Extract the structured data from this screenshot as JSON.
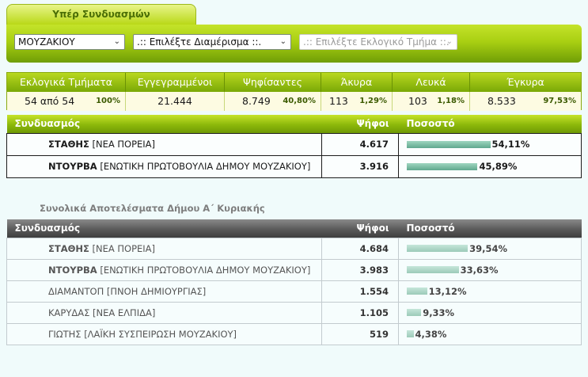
{
  "tab_title": "Υπέρ Συνδυασμών",
  "selectors": {
    "municipality": "ΜΟΥΖΑΚΙΟΥ",
    "district": ".:: Επιλέξτε Διαμέρισμα ::.",
    "section": ".:: Επιλέξτε Εκλογικό Τμήμα ::."
  },
  "stats": {
    "headers": [
      "Εκλογικά Τμήματα",
      "Εγγεγραμμένοι",
      "Ψηφίσαντες",
      "Άκυρα",
      "Λευκά",
      "Έγκυρα"
    ],
    "sections_value": "54 από 54",
    "sections_pct": "100%",
    "registered": "21.444",
    "voted": "8.749",
    "voted_pct": "40,80%",
    "invalid": "113",
    "invalid_pct": "1,29%",
    "blank": "103",
    "blank_pct": "1,18%",
    "valid": "8.533",
    "valid_pct": "97,53%"
  },
  "results_table": {
    "headers": {
      "combination": "Συνδυασμός",
      "votes": "Ψήφοι",
      "percent": "Ποσοστό"
    },
    "rows": [
      {
        "name": "ΣΤΑΘΗΣ",
        "party": "[ΝΕΑ ΠΟΡΕΙΑ]",
        "votes": "4.617",
        "percent": "54,11%",
        "share": 54.11
      },
      {
        "name": "ΝΤΟΥΡΒΑ",
        "party": "[ΕΝΩΤΙΚΗ ΠΡΩΤΟΒΟΥΛΙΑ ΔΗΜΟΥ ΜΟΥΖΑΚΙΟΥ]",
        "votes": "3.916",
        "percent": "45,89%",
        "share": 45.89
      }
    ]
  },
  "overall_title": "Συνολικά Αποτελέσματα Δήμου Α΄ Κυριακής",
  "overall_table": {
    "headers": {
      "combination": "Συνδυασμός",
      "votes": "Ψήφοι",
      "percent": "Ποσοστό"
    },
    "rows": [
      {
        "name": "ΣΤΑΘΗΣ",
        "party": "[ΝΕΑ ΠΟΡΕΙΑ]",
        "votes": "4.684",
        "percent": "39,54%",
        "share": 39.54,
        "bold": true
      },
      {
        "name": "ΝΤΟΥΡΒΑ",
        "party": "[ΕΝΩΤΙΚΗ ΠΡΩΤΟΒΟΥΛΙΑ ΔΗΜΟΥ ΜΟΥΖΑΚΙΟΥ]",
        "votes": "3.983",
        "percent": "33,63%",
        "share": 33.63,
        "bold": true
      },
      {
        "name": "ΔΙΑΜΑΝΤΟΠ",
        "party": "[ΠΝΟΗ ΔΗΜΙΟΥΡΓΙΑΣ]",
        "votes": "1.554",
        "percent": "13,12%",
        "share": 13.12,
        "bold": false
      },
      {
        "name": "ΚΑΡΥΔΑΣ",
        "party": "[ΝΕΑ ΕΛΠΙΔΑ]",
        "votes": "1.105",
        "percent": "9,33%",
        "share": 9.33,
        "bold": false
      },
      {
        "name": "ΓΙΩΤΗΣ",
        "party": "[ΛΑΪΚΗ ΣΥΣΠΕΙΡΩΣΗ ΜΟΥΖΑΚΙΟΥ]",
        "votes": "519",
        "percent": "4,38%",
        "share": 4.38,
        "bold": false
      }
    ]
  }
}
